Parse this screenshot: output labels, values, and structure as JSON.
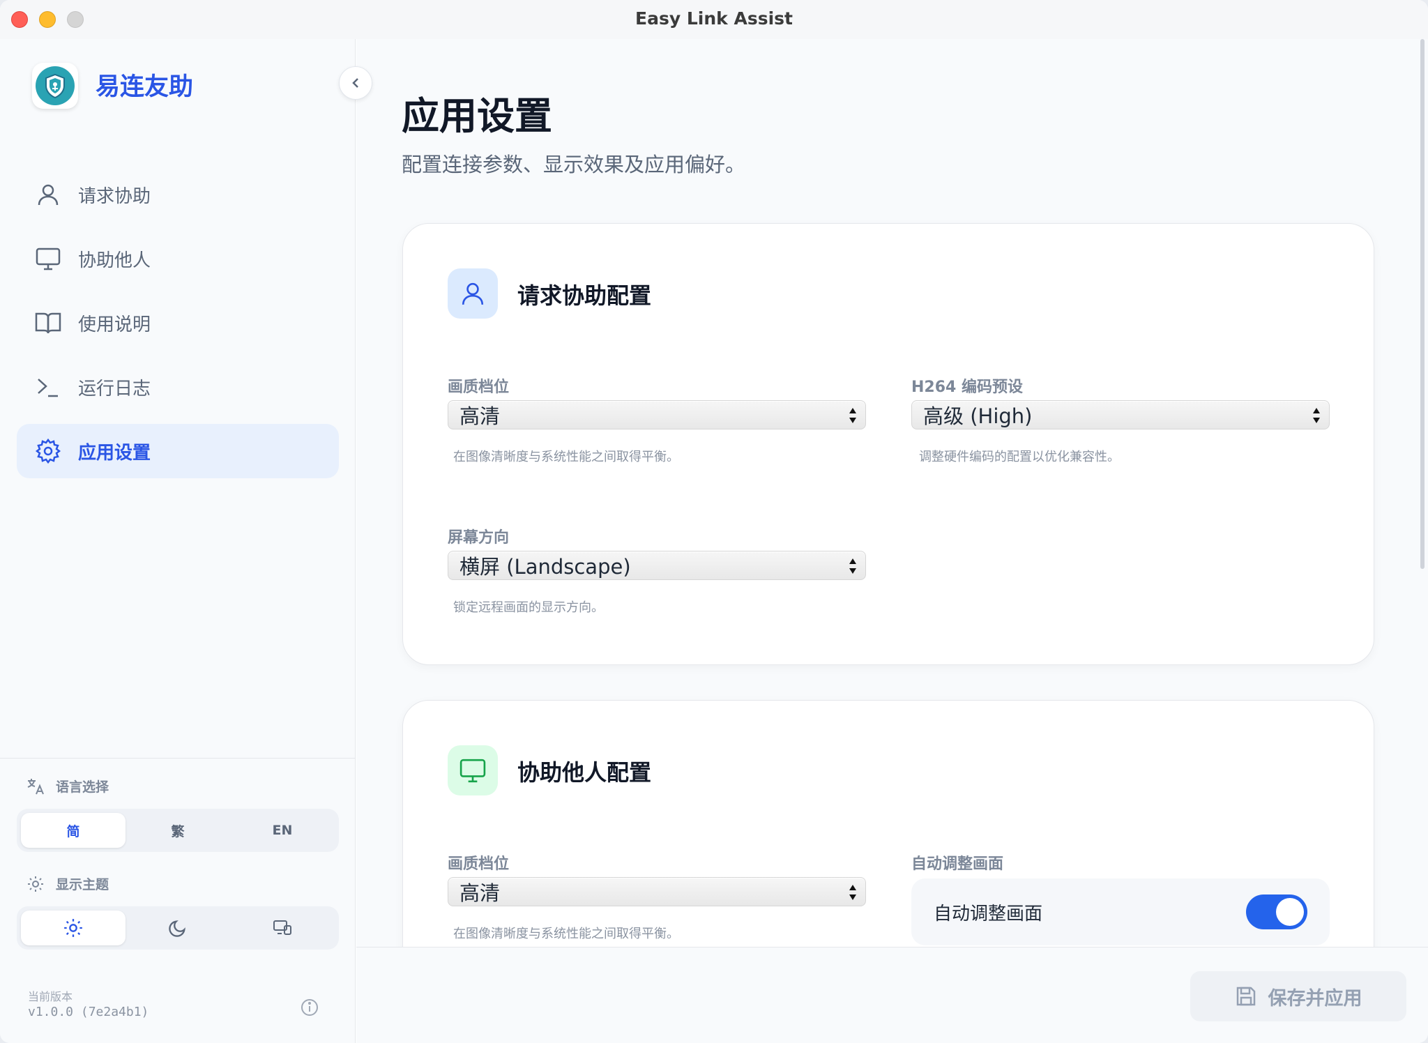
{
  "window": {
    "title": "Easy Link Assist"
  },
  "sidebar": {
    "brand": "易连友助",
    "items": [
      {
        "label": "请求协助",
        "icon": "user-icon"
      },
      {
        "label": "协助他人",
        "icon": "monitor-icon"
      },
      {
        "label": "使用说明",
        "icon": "book-icon"
      },
      {
        "label": "运行日志",
        "icon": "terminal-icon"
      },
      {
        "label": "应用设置",
        "icon": "gear-icon",
        "active": true
      }
    ],
    "language": {
      "label": "语言选择",
      "options": [
        "简",
        "繁",
        "EN"
      ],
      "selected": "简"
    },
    "theme": {
      "label": "显示主题",
      "options": [
        "sun-icon",
        "moon-icon",
        "system-icon"
      ],
      "selected": "sun-icon"
    },
    "version": {
      "label": "当前版本",
      "value": "v1.0.0 (7e2a4b1)"
    }
  },
  "main": {
    "title": "应用设置",
    "subtitle": "配置连接参数、显示效果及应用偏好。",
    "request_card": {
      "title": "请求协助配置",
      "quality": {
        "label": "画质档位",
        "value": "高清",
        "hint": "在图像清晰度与系统性能之间取得平衡。"
      },
      "h264": {
        "label": "H264 编码预设",
        "value": "高级 (High)",
        "hint": "调整硬件编码的配置以优化兼容性。"
      },
      "orientation": {
        "label": "屏幕方向",
        "value": "横屏 (Landscape)",
        "hint": "锁定远程画面的显示方向。"
      }
    },
    "assist_card": {
      "title": "协助他人配置",
      "quality": {
        "label": "画质档位",
        "value": "高清",
        "hint": "在图像清晰度与系统性能之间取得平衡。"
      },
      "auto_adjust": {
        "label": "自动调整画面",
        "toggle_label": "自动调整画面",
        "enabled": true
      }
    }
  },
  "footer": {
    "save_label": "保存并应用"
  },
  "colors": {
    "accent": "#2a55e5",
    "toggle_on": "#2463eb",
    "assist_icon": "#16a34a"
  }
}
